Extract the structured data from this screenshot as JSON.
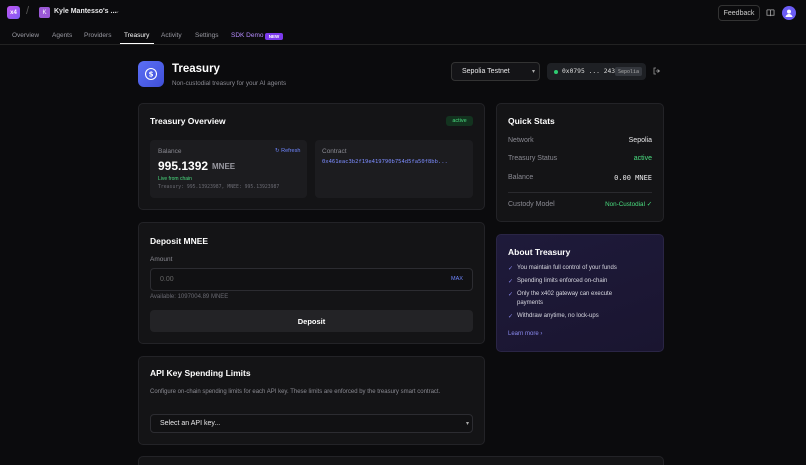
{
  "app": {
    "logo_text": "x4",
    "org_initial": "K",
    "org_name": "Kyle Mantesso's ...",
    "feedback_label": "Feedback"
  },
  "nav": {
    "tabs": [
      {
        "label": "Overview"
      },
      {
        "label": "Agents"
      },
      {
        "label": "Providers"
      },
      {
        "label": "Treasury"
      },
      {
        "label": "Activity"
      },
      {
        "label": "Settings"
      },
      {
        "label": "SDK Demo"
      }
    ],
    "active_tab": "Treasury",
    "new_badge": "NEW"
  },
  "header": {
    "title": "Treasury",
    "subtitle": "Non-custodial treasury for your AI agents",
    "network_select": "Sepolia Testnet",
    "wallet_address": "0x0795 ... 2433",
    "wallet_network": "Sepolia"
  },
  "overview": {
    "title": "Treasury Overview",
    "status": "active",
    "balance_label": "Balance",
    "refresh_label": "Refresh",
    "balance_value": "995.1392",
    "balance_unit": "MNEE",
    "live_label": "Live from chain",
    "balance_detail": "Treasury: 995.13923987, MNEE: 995.13923987",
    "contract_label": "Contract",
    "contract_address": "0x461eac3b2f19e419790b754d5fa50f8bb..."
  },
  "deposit": {
    "title": "Deposit MNEE",
    "amount_label": "Amount",
    "amount_placeholder": "0.00",
    "max_label": "MAX",
    "available": "Available: 1097004.89 MNEE",
    "button_label": "Deposit"
  },
  "api_limits": {
    "title": "API Key Spending Limits",
    "description": "Configure on-chain spending limits for each API key. These limits are enforced by the treasury smart contract.",
    "select_value": "Select an API key..."
  },
  "quick_stats": {
    "title": "Quick Stats",
    "network_label": "Network",
    "network_value": "Sepolia",
    "status_label": "Treasury Status",
    "status_value": "active",
    "balance_label": "Balance",
    "balance_value": "0.00 MNEE",
    "custody_label": "Custody Model",
    "custody_value": "Non-Custodial ✓"
  },
  "about": {
    "title": "About Treasury",
    "items": [
      "You maintain full control of your funds",
      "Spending limits enforced on-chain",
      "Only the x402 gateway can execute",
      "payments",
      "Withdraw anytime, no lock-ups"
    ],
    "learn_more": "Learn more"
  },
  "colors": {
    "accent": "#6f86ff",
    "success": "#4ade80",
    "brand": "#7c3aed"
  }
}
